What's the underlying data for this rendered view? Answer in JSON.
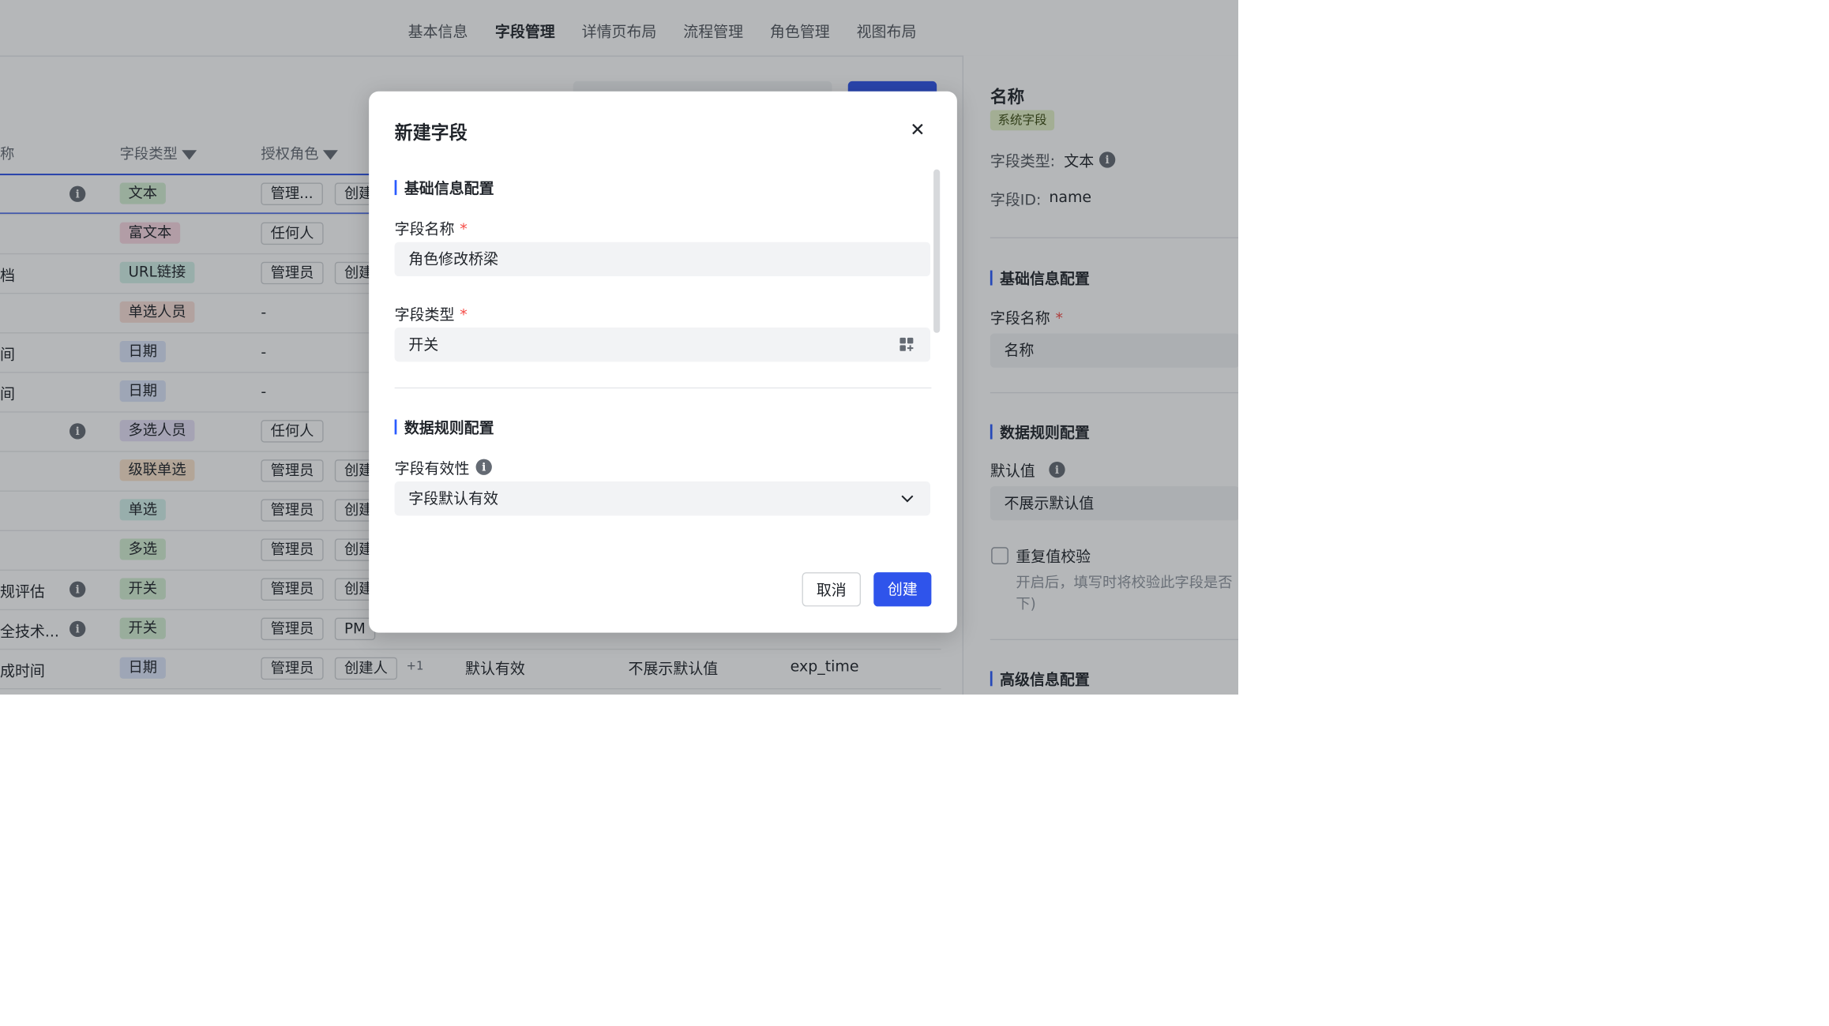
{
  "tabs": [
    {
      "label": "基本信息"
    },
    {
      "label": "字段管理"
    },
    {
      "label": "详情页布局"
    },
    {
      "label": "流程管理"
    },
    {
      "label": "角色管理"
    },
    {
      "label": "视图布局"
    }
  ],
  "table": {
    "headers": {
      "name": "称",
      "type": "字段类型",
      "roles": "授权角色"
    },
    "rows": [
      {
        "name": "",
        "info": true,
        "type": "文本",
        "roles": [
          "管理...",
          "创建"
        ],
        "dash": false
      },
      {
        "name": "",
        "info": false,
        "type": "富文本",
        "roles": [
          "任何人"
        ],
        "dash": false
      },
      {
        "name": "档",
        "info": false,
        "type": "URL链接",
        "roles": [
          "管理员",
          "创建"
        ],
        "dash": false
      },
      {
        "name": "",
        "info": false,
        "type": "单选人员",
        "roles": [],
        "dash": true
      },
      {
        "name": "间",
        "info": false,
        "type": "日期",
        "roles": [],
        "dash": true
      },
      {
        "name": "间",
        "info": false,
        "type": "日期",
        "roles": [],
        "dash": true
      },
      {
        "name": "",
        "info": true,
        "type": "多选人员",
        "roles": [
          "任何人"
        ],
        "dash": false
      },
      {
        "name": "",
        "info": false,
        "type": "级联单选",
        "roles": [
          "管理员",
          "创建"
        ],
        "dash": false
      },
      {
        "name": "",
        "info": false,
        "type": "单选",
        "roles": [
          "管理员",
          "创建"
        ],
        "dash": false
      },
      {
        "name": "",
        "info": false,
        "type": "多选",
        "roles": [
          "管理员",
          "创建"
        ],
        "dash": false
      },
      {
        "name": "规评估",
        "info": true,
        "type": "开关",
        "roles": [
          "管理员",
          "创建"
        ],
        "dash": false
      },
      {
        "name": "全技术...",
        "info": true,
        "type": "开关",
        "roles": [
          "管理员",
          "PM"
        ],
        "dash": false
      },
      {
        "name": "成时间",
        "info": false,
        "type": "日期",
        "roles": [
          "管理员",
          "创建人"
        ],
        "dash": false
      }
    ],
    "last_row_extra": {
      "more": "+1",
      "validity": "默认有效",
      "default": "不展示默认值",
      "id": "exp_time"
    }
  },
  "tag_colors": {
    "文本": "#d6f0d4",
    "富文本": "#fbd9e3",
    "URL链接": "#d4f2e9",
    "单选人员": "#fbe0d8",
    "日期": "#dde6fb",
    "多选人员": "#e8e1f8",
    "级联单选": "#fce4cc",
    "单选": "#d4f2ec",
    "多选": "#d6f0d4",
    "开关": "#d6f0d4"
  },
  "panel": {
    "title": "名称",
    "badge": "系统字段",
    "type_label": "字段类型:",
    "type_value": "文本",
    "id_label": "字段ID:",
    "id_value": "name",
    "section1": "基础信息配置",
    "name_label": "字段名称",
    "required": "*",
    "name_value": "名称",
    "section2": "数据规则配置",
    "default_label": "默认值",
    "default_value": "不展示默认值",
    "dup_label": "重复值校验",
    "dup_desc_1": "开启后，填写时将校验此字段是否",
    "dup_desc_2": "下)",
    "section3": "高级信息配置"
  },
  "modal": {
    "title": "新建字段",
    "close": "✕",
    "section_basic": "基础信息配置",
    "field_name_label": "字段名称",
    "required": "*",
    "field_name_value": "角色修改桥梁",
    "field_type_label": "字段类型",
    "field_type_value": "开关",
    "section_rules": "数据规则配置",
    "validity_label": "字段有效性",
    "validity_value": "字段默认有效",
    "cancel": "取消",
    "create": "创建"
  },
  "accent_color": "#2f54eb"
}
